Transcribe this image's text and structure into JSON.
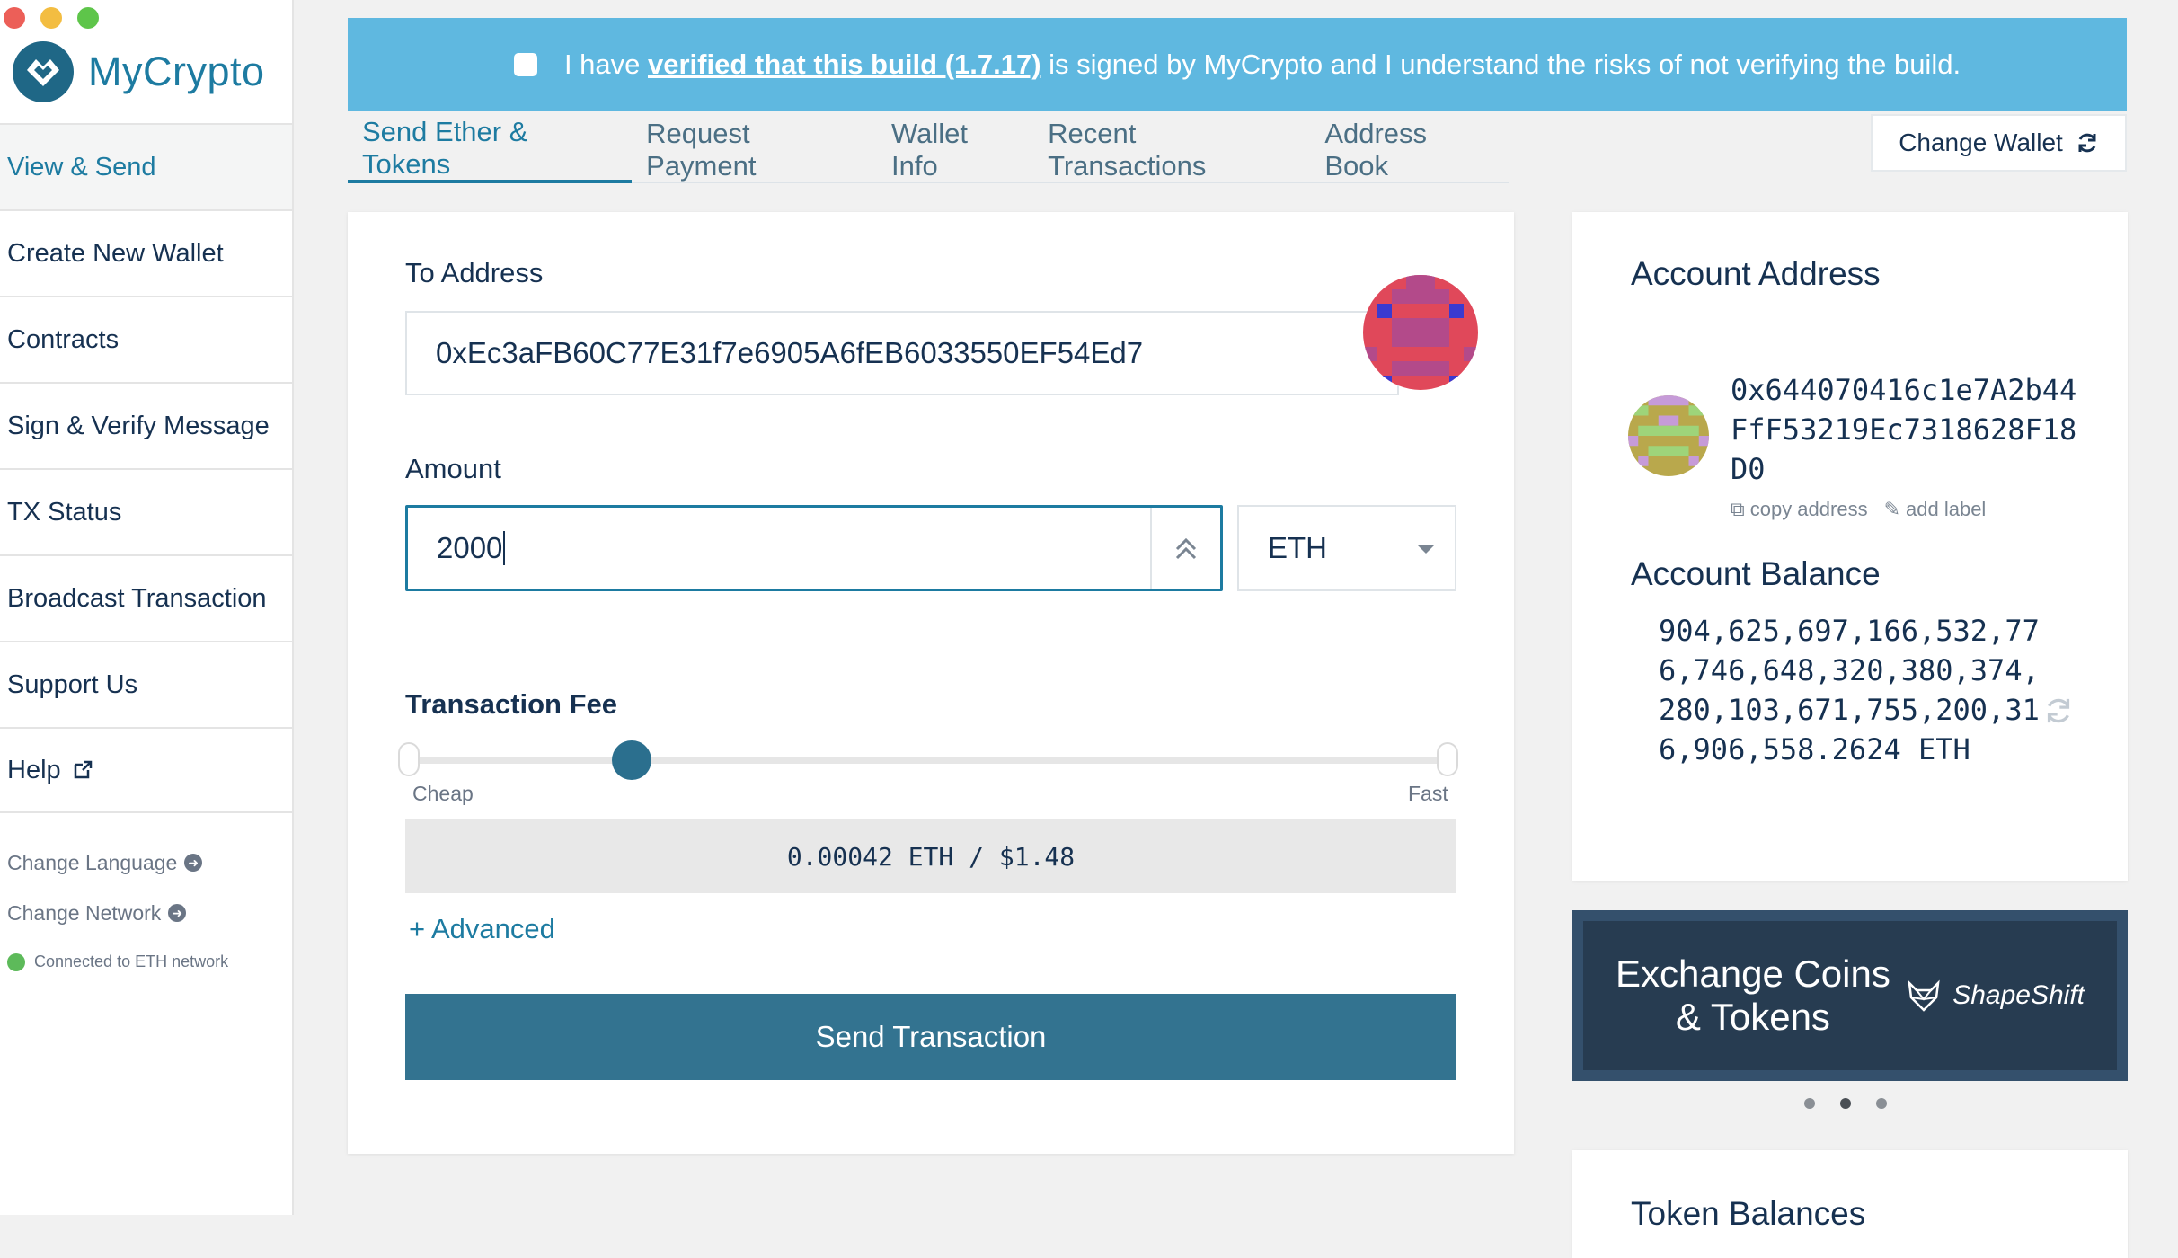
{
  "app": {
    "name": "MyCrypto"
  },
  "sidebar": {
    "items": [
      {
        "label": "View & Send"
      },
      {
        "label": "Create New Wallet"
      },
      {
        "label": "Contracts"
      },
      {
        "label": "Sign & Verify Message"
      },
      {
        "label": "TX Status"
      },
      {
        "label": "Broadcast Transaction"
      },
      {
        "label": "Support Us"
      },
      {
        "label": "Help"
      }
    ],
    "change_language": "Change Language",
    "change_network": "Change Network",
    "connection_status": "Connected to ETH network"
  },
  "banner": {
    "prefix": "I have ",
    "link_text": "verified that this build (1.7.17)",
    "suffix": " is signed by MyCrypto and I understand the risks of not verifying the build."
  },
  "tabs": [
    {
      "label": "Send Ether & Tokens"
    },
    {
      "label": "Request Payment"
    },
    {
      "label": "Wallet Info"
    },
    {
      "label": "Recent Transactions"
    },
    {
      "label": "Address Book"
    }
  ],
  "change_wallet_label": "Change Wallet",
  "send": {
    "to_address_label": "To Address",
    "to_address_value": "0xEc3aFB60C77E31f7e6905A6fEB6033550EF54Ed7",
    "amount_label": "Amount",
    "amount_value": "2000",
    "unit": "ETH",
    "fee_label": "Transaction Fee",
    "fee_min_label": "Cheap",
    "fee_max_label": "Fast",
    "fee_slider_level": 0.21,
    "fee_value": "0.00042 ETH / $1.48",
    "advanced_label": "+ Advanced",
    "send_button": "Send Transaction"
  },
  "account": {
    "title": "Account Address",
    "address": "0x644070416c1e7A2b44FfF53219Ec7318628F18D0",
    "copy_label": "copy address",
    "add_label": "add label",
    "balance_title": "Account Balance",
    "balance_value": "904,625,697,166,532,776,746,648,320,380,374,280,103,671,755,200,316,906,558.2624 ETH"
  },
  "ad": {
    "headline_line1": "Exchange Coins",
    "headline_line2": "& Tokens",
    "brand": "ShapeShift"
  },
  "token_balances_title": "Token Balances",
  "colors": {
    "accent": "#1d7ba1",
    "banner": "#5fb8e0",
    "button": "#337390"
  }
}
